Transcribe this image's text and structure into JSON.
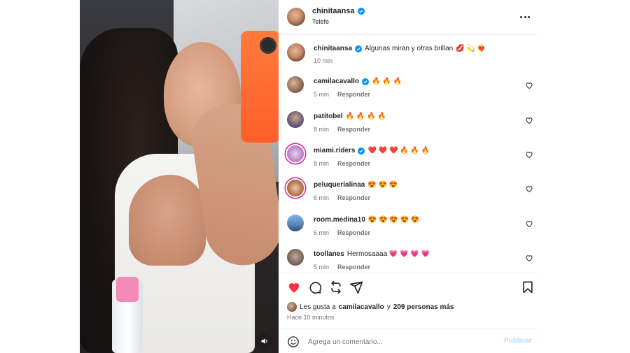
{
  "post": {
    "username": "chinitaansa",
    "location": "Telefe",
    "caption_text": "Algunas miran y otras brillan",
    "caption_emojis": "💋 💫 ❤️‍🔥",
    "caption_time": "10 min"
  },
  "comments": [
    {
      "username": "camilacavallo",
      "verified": true,
      "text": "🔥 🔥 🔥",
      "time": "5 min",
      "reply": "Responder"
    },
    {
      "username": "patitobel",
      "verified": false,
      "text": "🔥 🔥 🔥 🔥",
      "time": "8 min",
      "reply": "Responder"
    },
    {
      "username": "miami.riders",
      "verified": true,
      "text": "❤️ ❤️ ❤️ 🔥 🔥 🔥",
      "time": "8 min",
      "reply": "Responder"
    },
    {
      "username": "peluquerialinaa",
      "verified": false,
      "text": "😍 😍 😍",
      "time": "6 min",
      "reply": "Responder"
    },
    {
      "username": "room.medina10",
      "verified": false,
      "text": "😍 😍 😍 😍 😍",
      "time": "6 min",
      "reply": "Responder"
    },
    {
      "username": "toollanes",
      "verified": false,
      "text": "Hermosaaaa 💗 💗 💗 💗",
      "time": "5 min",
      "reply": "Responder"
    }
  ],
  "likes": {
    "prefix": "Les gusta a",
    "user": "camilacavallo",
    "middle": "y",
    "others": "209 personas más"
  },
  "posted_ago": "Hace 10 minutos",
  "add_comment": {
    "placeholder": "Agrega un comentario...",
    "post_label": "Publicar"
  },
  "colors": {
    "verified_blue": "#0095f6",
    "like_red": "#ff3040",
    "post_button": "#b3dbff",
    "story_ring": "#d6249f"
  },
  "icons": {
    "more": "more-horizontal-icon",
    "like": "heart-filled-icon",
    "comment": "comment-bubble-icon",
    "repost": "repost-icon",
    "share": "send-icon",
    "save": "bookmark-icon",
    "emoji": "emoji-smile-icon",
    "sound": "speaker-icon"
  }
}
